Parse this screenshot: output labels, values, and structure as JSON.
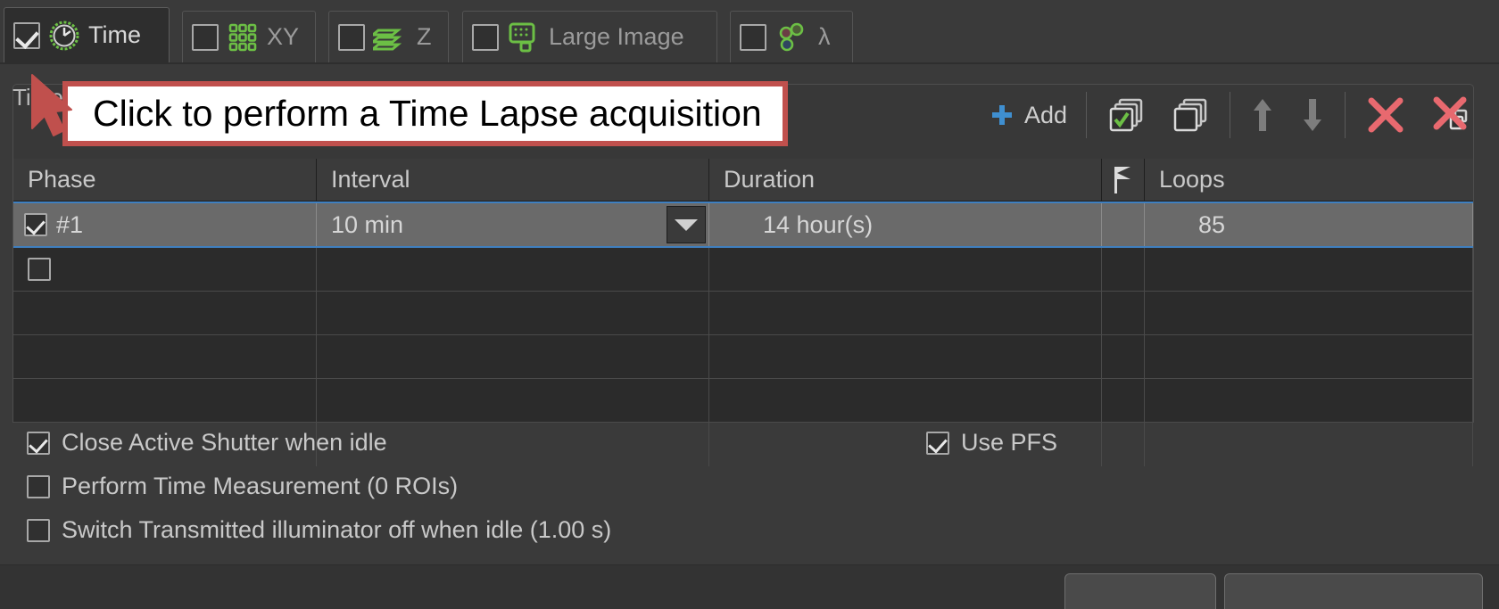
{
  "window": {
    "accent_blue": "#3f7fbf",
    "green": "#6cbf45",
    "tooltip_border": "#c0504d",
    "cursor_color": "#c0504d"
  },
  "tabs": [
    {
      "id": "time",
      "label": "Time",
      "icon": "clock-icon",
      "checked": true,
      "active": true
    },
    {
      "id": "xy",
      "label": "XY",
      "icon": "grid-xy-icon",
      "checked": false,
      "active": false
    },
    {
      "id": "z",
      "label": "Z",
      "icon": "z-stack-icon",
      "checked": false,
      "active": false
    },
    {
      "id": "large-image",
      "label": "Large Image",
      "icon": "large-image-icon",
      "checked": false,
      "active": false
    },
    {
      "id": "lambda",
      "label": "λ",
      "icon": "lambda-icon",
      "checked": false,
      "active": false
    }
  ],
  "toolbar": {
    "title": "Time Schedule",
    "add_label": "Add",
    "add_icon": "plus-icon",
    "check_all_icon": "check-all-pages-icon",
    "uncheck_all_icon": "uncheck-all-pages-icon",
    "move_up_icon": "arrow-up-icon",
    "move_down_icon": "arrow-down-icon",
    "remove_icon": "remove-x-icon",
    "remove_all_icon": "remove-all-x-icon"
  },
  "table": {
    "columns": [
      {
        "key": "phase",
        "label": "Phase"
      },
      {
        "key": "interval",
        "label": "Interval"
      },
      {
        "key": "duration",
        "label": "Duration"
      },
      {
        "key": "flag",
        "label": "",
        "icon": "flag-icon"
      },
      {
        "key": "loops",
        "label": "Loops"
      }
    ],
    "rows": [
      {
        "checked": true,
        "selected": true,
        "phase": "#1",
        "interval": "10 min",
        "duration": "14 hour(s)",
        "loops": "85"
      },
      {
        "checked": false,
        "selected": false,
        "phase": "",
        "interval": "",
        "duration": "",
        "loops": ""
      }
    ],
    "empty_row_count": 4
  },
  "options": [
    {
      "id": "close-active-shutter",
      "label": "Close Active Shutter when idle",
      "checked": true
    },
    {
      "id": "perform-time-measurement",
      "label": "Perform Time Measurement (0 ROIs)",
      "checked": false
    },
    {
      "id": "switch-transmitted-illuminator",
      "label": "Switch Transmitted illuminator off when idle (1.00 s)",
      "checked": false
    },
    {
      "id": "use-pfs",
      "label": "Use PFS",
      "checked": true
    }
  ],
  "tooltip": {
    "text": "Click to perform a Time Lapse acquisition"
  }
}
